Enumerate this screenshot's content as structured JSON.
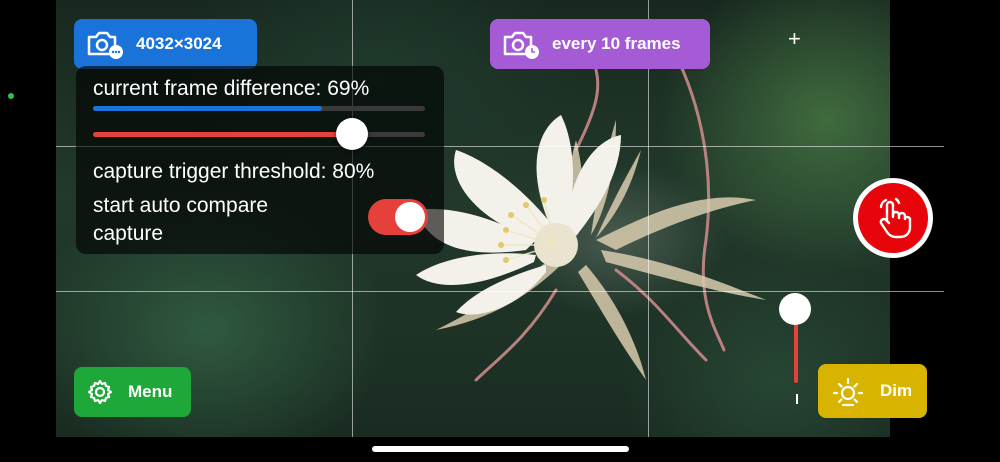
{
  "camera": {
    "resolution_label": "4032×3024",
    "interval_label": "every 10 frames"
  },
  "panel": {
    "frame_difference_label": "current frame difference: 69%",
    "frame_difference_value": 0.69,
    "threshold_label": "capture trigger threshold: 80%",
    "threshold_value": 0.78,
    "auto_compare_label": "start auto compare capture",
    "auto_compare_enabled": true
  },
  "zoom": {
    "plus_label": "+"
  },
  "buttons": {
    "menu_label": "Menu",
    "dim_label": "Dim"
  },
  "colors": {
    "resolution_pill": "#1a73d9",
    "interval_pill": "#a55bd6",
    "menu_pill": "#1fa83a",
    "dim_pill": "#d8b400",
    "capture_button": "#e8040b"
  },
  "icons": {
    "resolution": "camera-more-icon",
    "interval": "camera-timer-icon",
    "menu": "gear-icon",
    "dim": "sun-icon",
    "capture": "hand-pointer-icon"
  }
}
